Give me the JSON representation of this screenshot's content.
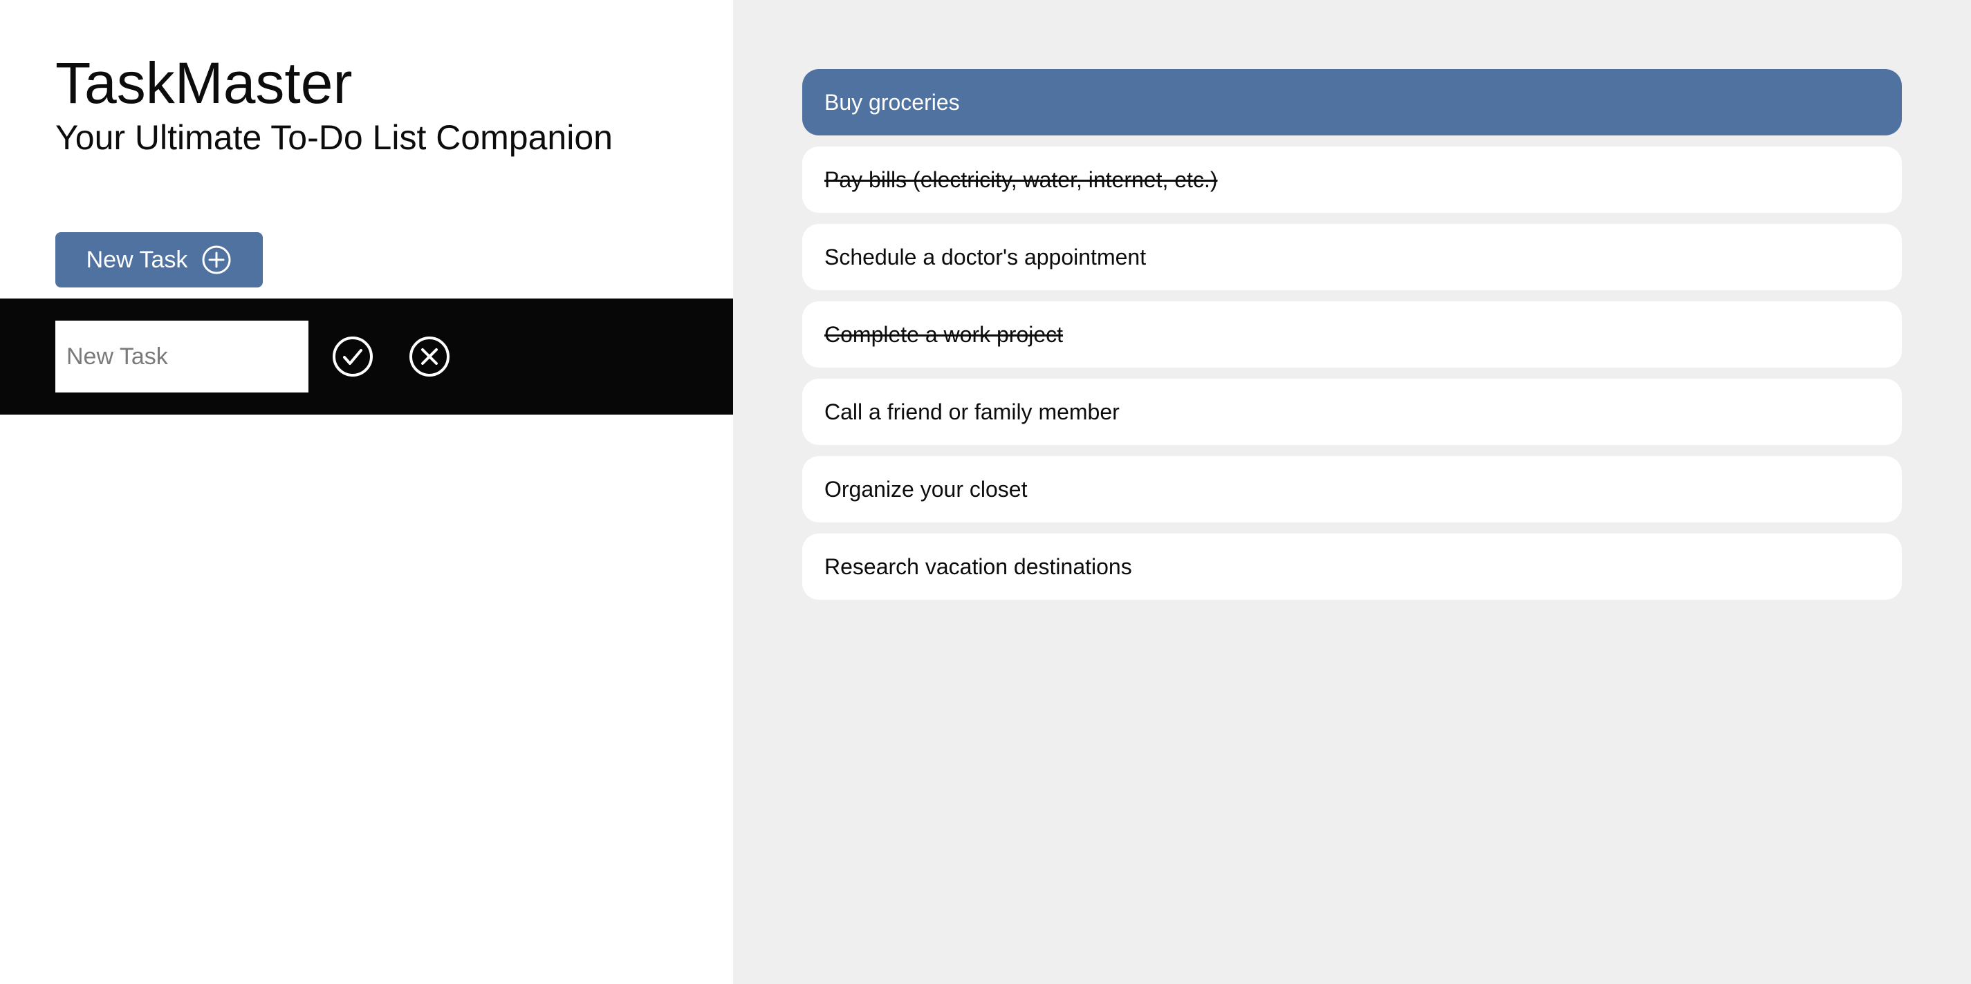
{
  "header": {
    "title": "TaskMaster",
    "subtitle": "Your Ultimate To-Do List Companion"
  },
  "new_task_button": {
    "label": "New Task",
    "icon": "plus-circle-icon"
  },
  "entry": {
    "placeholder": "New Task",
    "value": "",
    "confirm_icon": "check-circle-icon",
    "cancel_icon": "x-circle-icon"
  },
  "tasks": [
    {
      "text": "Buy groceries",
      "completed": false,
      "selected": true
    },
    {
      "text": "Pay bills (electricity, water, internet, etc.)",
      "completed": true,
      "selected": false
    },
    {
      "text": "Schedule a doctor's appointment",
      "completed": false,
      "selected": false
    },
    {
      "text": "Complete a work project",
      "completed": true,
      "selected": false
    },
    {
      "text": "Call a friend or family member",
      "completed": false,
      "selected": false
    },
    {
      "text": "Organize your closet",
      "completed": false,
      "selected": false
    },
    {
      "text": "Research vacation destinations",
      "completed": false,
      "selected": false
    }
  ],
  "colors": {
    "accent": "#5072a0",
    "entry_bar": "#070707",
    "list_background": "#efefef",
    "card": "#ffffff"
  }
}
